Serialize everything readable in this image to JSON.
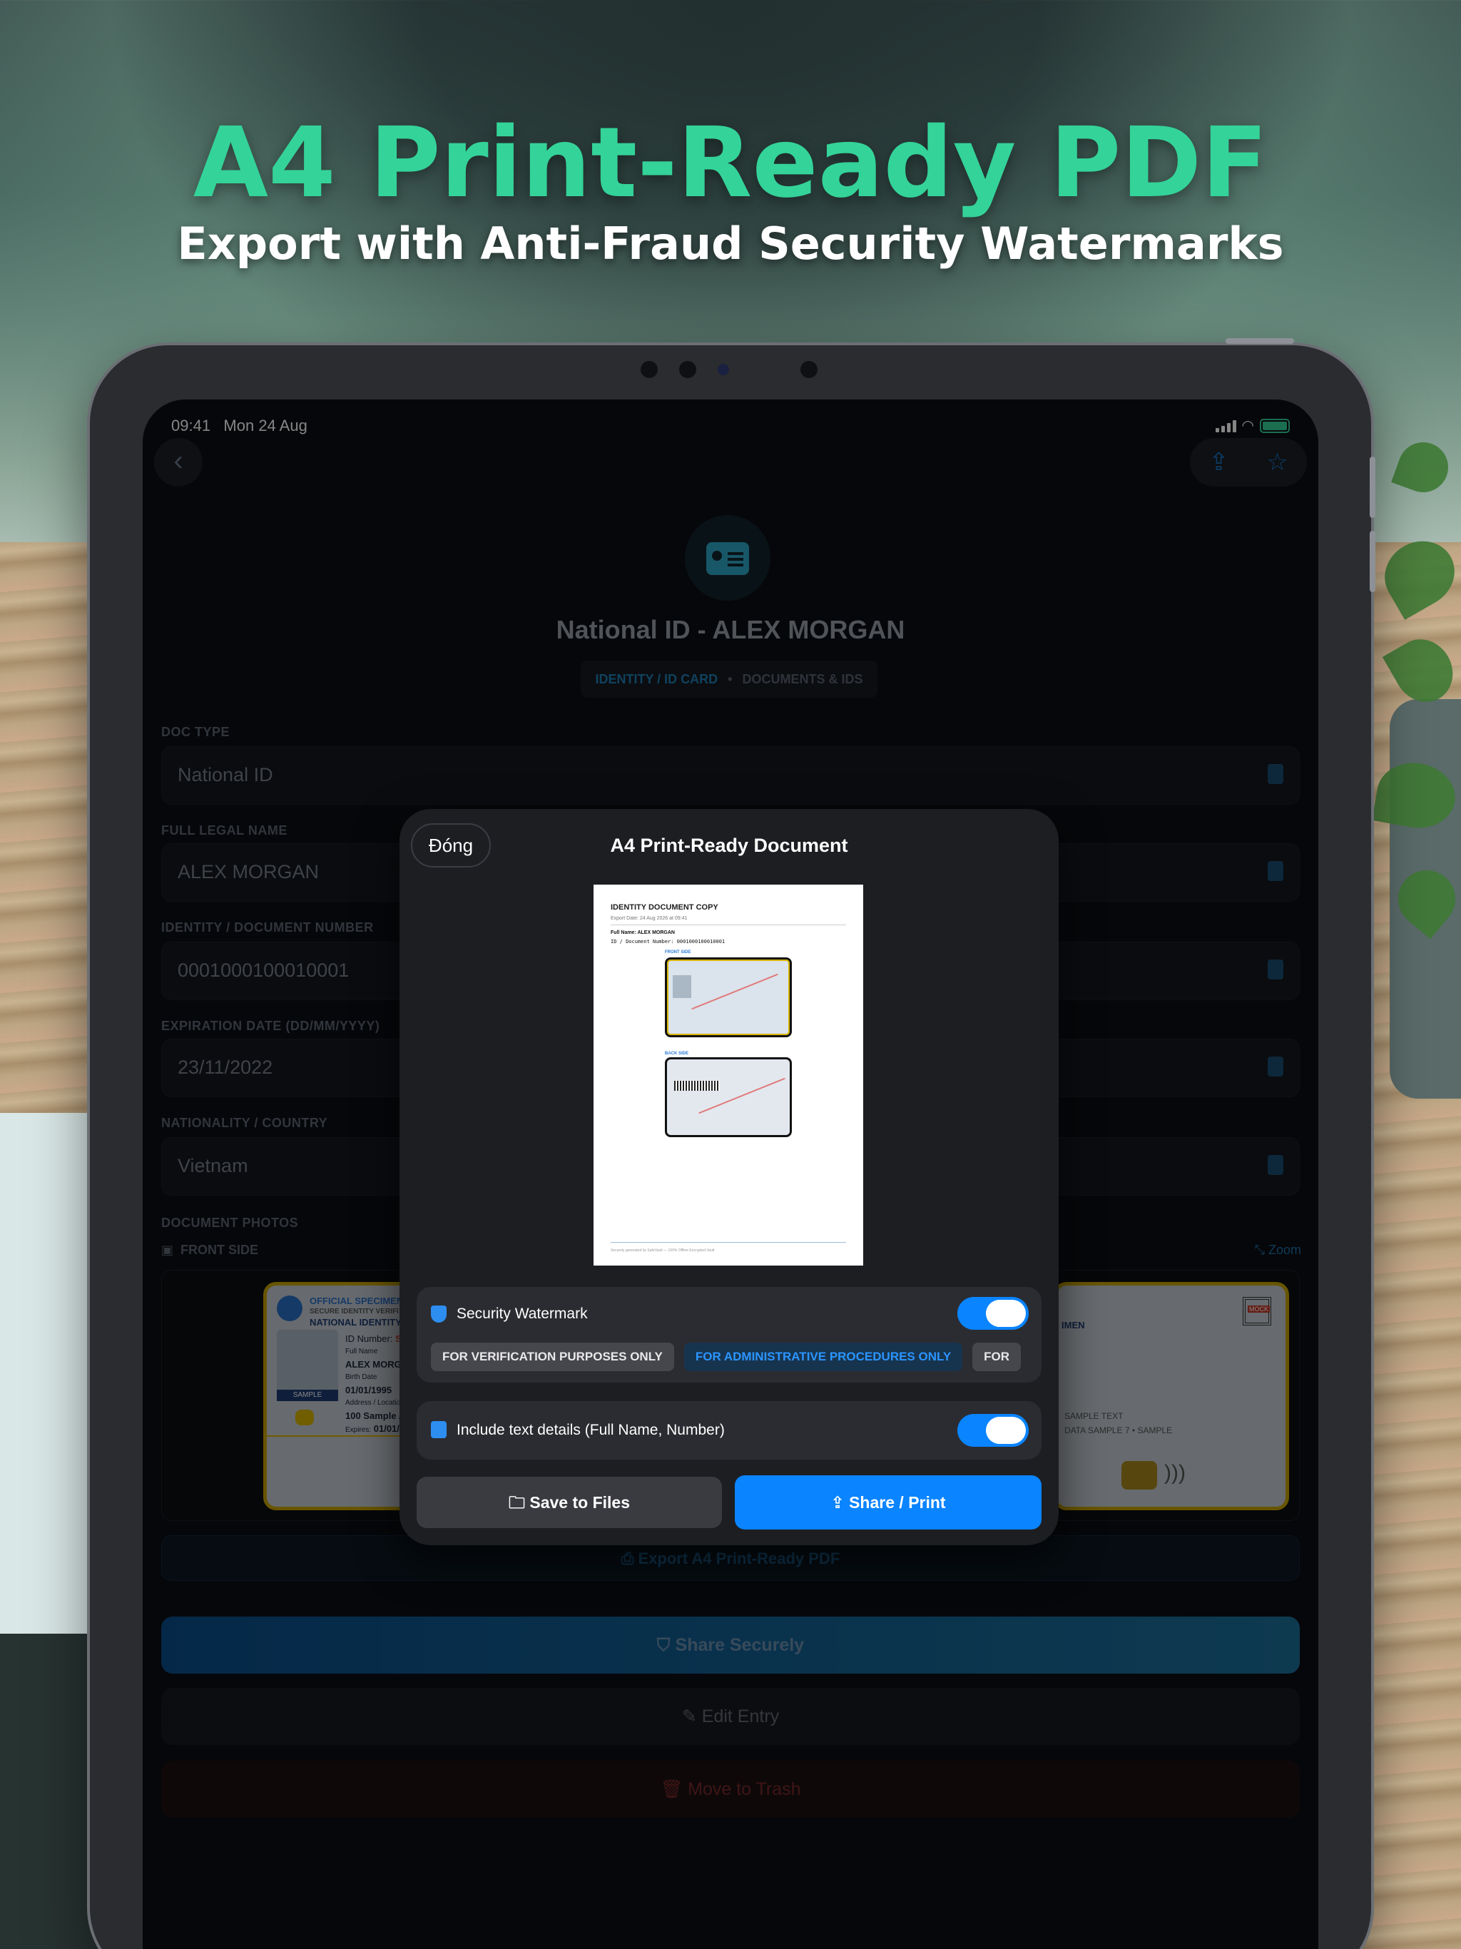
{
  "marketing": {
    "headline": "A4 Print-Ready PDF",
    "subheadline": "Export with Anti-Fraud Security Watermarks"
  },
  "status_bar": {
    "time": "09:41",
    "date": "Mon 24 Aug"
  },
  "nav": {
    "back_icon": "chevron-left-icon",
    "share_icon": "share-icon",
    "favorite_icon": "star-icon"
  },
  "document": {
    "title": "National ID - ALEX MORGAN",
    "category": "IDENTITY / ID CARD",
    "separator": "•",
    "folder": "DOCUMENTS & IDS"
  },
  "fields": [
    {
      "label": "DOC TYPE",
      "value": "National ID"
    },
    {
      "label": "FULL LEGAL NAME",
      "value": "ALEX MORGAN"
    },
    {
      "label": "IDENTITY / DOCUMENT NUMBER",
      "value": "0001000100010001"
    },
    {
      "label": "EXPIRATION DATE (DD/MM/YYYY)",
      "value": "23/11/2022"
    },
    {
      "label": "NATIONALITY / COUNTRY",
      "value": "Vietnam"
    }
  ],
  "photos": {
    "section_label": "DOCUMENT PHOTOS",
    "side_label": "FRONT SIDE",
    "zoom_label": "Zoom",
    "front_card": {
      "header_1": "OFFICIAL SPECIMEN -",
      "header_2": "SECURE IDENTITY VERIFI",
      "header_3": "NATIONAL IDENTITY",
      "id_label": "ID Number:",
      "id_value": "SP",
      "name_label": "Full Name",
      "name_value": "ALEX MORG",
      "birth_label": "Birth Date",
      "birth_value": "01/01/1995",
      "address_label": "Address / Location",
      "address_value": "100 Sample Av",
      "expires_label": "Expires:",
      "expires_value": "01/01/",
      "photo_tag": "SAMPLE"
    },
    "back_card": {
      "header": "IMEN",
      "qr_tag": "MOCK",
      "line_1": "SAMPLE TEXT",
      "line_2": "DATA SAMPLE 7 • SAMPLE"
    }
  },
  "actions": {
    "export_label": "Export A4 Print-Ready PDF",
    "share_label": "Share Securely",
    "edit_label": "Edit Entry",
    "trash_label": "Move to Trash"
  },
  "modal": {
    "close_label": "Đóng",
    "title": "A4 Print-Ready Document",
    "preview": {
      "heading": "IDENTITY DOCUMENT COPY",
      "export_date": "Export Date: 24 Aug 2026 at 09:41",
      "full_name_line": "Full Name: ALEX MORGAN",
      "id_line": "ID / Document Number: 0001000100010001",
      "front_label": "FRONT SIDE",
      "back_label": "BACK SIDE",
      "footer": "Securely generated by SafeVault — 100% Offline Encrypted Vault"
    },
    "watermark": {
      "label": "Security Watermark",
      "enabled": true,
      "options": [
        {
          "label": "FOR VERIFICATION PURPOSES ONLY",
          "selected": false
        },
        {
          "label": "FOR ADMINISTRATIVE PROCEDURES ONLY",
          "selected": true
        },
        {
          "label": "FOR",
          "selected": false
        }
      ]
    },
    "text_details": {
      "label": "Include text details (Full Name, Number)",
      "enabled": true
    },
    "save_label": "Save to Files",
    "print_label": "Share / Print"
  },
  "colors": {
    "headline_green": "#34d399",
    "accent_blue": "#0a84ff",
    "modal_bg": "#1d1e22",
    "screen_bg": "#0d0f14"
  }
}
